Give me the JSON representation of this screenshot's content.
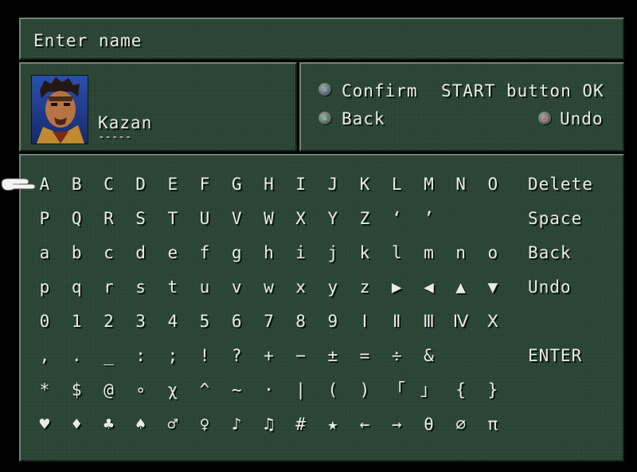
{
  "header": {
    "title": "Enter name"
  },
  "name_entry": {
    "character_name": "Kazan",
    "blank_slots": "-----",
    "portrait_icon": "character-portrait"
  },
  "controls": {
    "confirm_label": "Confirm",
    "start_label": "START button OK",
    "back_label": "Back",
    "undo_label": "Undo",
    "confirm_icon": "cross-button-icon",
    "back_icon": "triangle-button-icon",
    "undo_icon": "circle-button-icon"
  },
  "keyboard": {
    "rows": [
      [
        "A",
        "B",
        "C",
        "D",
        "E",
        "F",
        "G",
        "H",
        "I",
        "J",
        "K",
        "L",
        "M",
        "N",
        "O"
      ],
      [
        "P",
        "Q",
        "R",
        "S",
        "T",
        "U",
        "V",
        "W",
        "X",
        "Y",
        "Z",
        "‘",
        "’",
        "",
        ""
      ],
      [
        "a",
        "b",
        "c",
        "d",
        "e",
        "f",
        "g",
        "h",
        "i",
        "j",
        "k",
        "l",
        "m",
        "n",
        "o"
      ],
      [
        "p",
        "q",
        "r",
        "s",
        "t",
        "u",
        "v",
        "w",
        "x",
        "y",
        "z",
        "▶",
        "◀",
        "▲",
        "▼"
      ],
      [
        "0",
        "1",
        "2",
        "3",
        "4",
        "5",
        "6",
        "7",
        "8",
        "9",
        "Ⅰ",
        "Ⅱ",
        "Ⅲ",
        "Ⅳ",
        "Ⅹ"
      ],
      [
        ",",
        ".",
        "_",
        ":",
        ";",
        "!",
        "?",
        "+",
        "−",
        "±",
        "=",
        "÷",
        "&",
        "",
        ""
      ],
      [
        "*",
        "$",
        "@",
        "∘",
        "χ",
        "^",
        "~",
        "·",
        "|",
        "(",
        ")",
        "「",
        "」",
        "{",
        "}"
      ],
      [
        "♥",
        "♦",
        "♣",
        "♠",
        "♂",
        "♀",
        "♪",
        "♫",
        "#",
        "★",
        "←",
        "→",
        "θ",
        "∅",
        "π"
      ]
    ],
    "commands": [
      "Delete",
      "Space",
      "Back",
      "Undo",
      "",
      "ENTER"
    ]
  },
  "cursor": {
    "icon": "pointing-hand-cursor-icon",
    "selected": "A"
  },
  "colors": {
    "panel": "#2a4434",
    "text": "#e8ece6",
    "cross": "#7aa8ff",
    "triangle": "#5ecf7a",
    "circle": "#ff7070"
  }
}
